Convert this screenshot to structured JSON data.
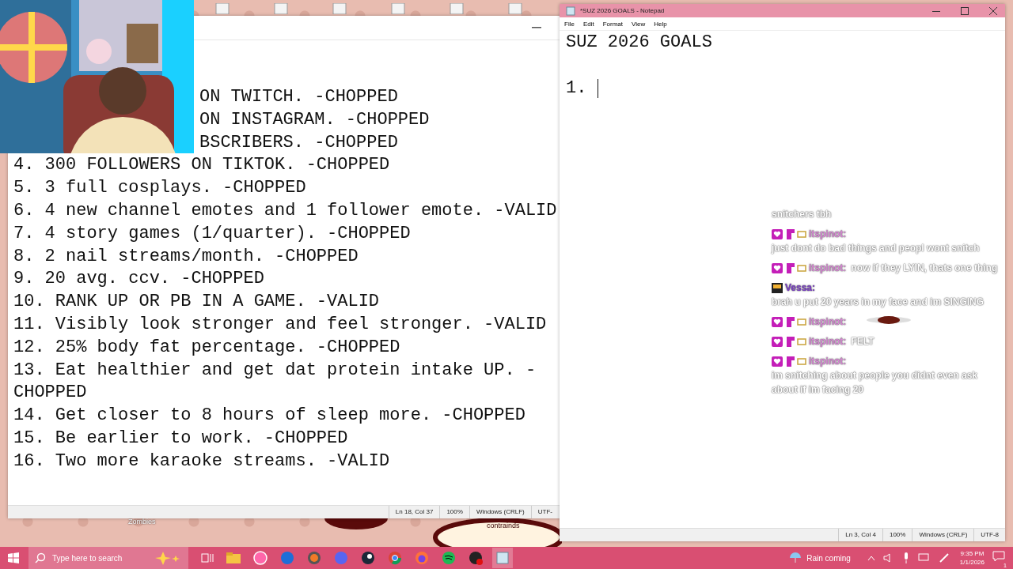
{
  "webcam": {
    "kind": "picture"
  },
  "left_notepad": {
    "covered_lines": [
      "ON TWITCH. -CHOPPED",
      "ON INSTAGRAM. -CHOPPED",
      "BSCRIBERS. -CHOPPED"
    ],
    "lines": [
      "4. 300 FOLLOWERS ON TIKTOK. -CHOPPED",
      "5. 3 full cosplays. -CHOPPED",
      "6. 4 new channel emotes and 1 follower emote. -VALID",
      "7. 4 story games (1/quarter). -CHOPPED",
      "8. 2 nail streams/month. -CHOPPED",
      "9. 20 avg. ccv. -CHOPPED",
      "10. RANK UP OR PB IN A GAME. -VALID",
      "11. Visibly look stronger and feel stronger. -VALID",
      "12. 25% body fat percentage. -CHOPPED",
      "13. Eat healthier and get dat protein intake UP. -CHOPPED",
      "14. Get closer to 8 hours of sleep more. -CHOPPED",
      "15. Be earlier to work. -CHOPPED",
      "16. Two more karaoke streams. -VALID"
    ],
    "status_bar": [
      "Ln 18, Col 37",
      "100%",
      "Windows (CRLF)",
      "UTF-"
    ]
  },
  "right_notepad": {
    "title": "*SUZ 2026 GOALS - Notepad",
    "menu": [
      "File",
      "Edit",
      "Format",
      "View",
      "Help"
    ],
    "heading": "SUZ 2026 GOALS",
    "list_start": "1.",
    "status_bar": [
      "Ln 3, Col 4",
      "100%",
      "Windows (CRLF)",
      "UTF-8"
    ]
  },
  "chat": {
    "messages": [
      {
        "kind": "continuation",
        "text": "snitchers tbh"
      },
      {
        "kind": "text",
        "user": "itspinot:",
        "color": "#d98ad6",
        "text": "just dont do bad things and peopl wont snitch"
      },
      {
        "kind": "text",
        "user": "itspinot:",
        "color": "#d98ad6",
        "text": "now if they LYIN, thats one thing"
      },
      {
        "kind": "text",
        "user": "Vessa:",
        "color": "#7a3fc4",
        "text": "brah u put 20 years in my face and im SINGING"
      },
      {
        "kind": "emote",
        "user": "itspinot:",
        "color": "#d98ad6"
      },
      {
        "kind": "text",
        "user": "itspinot:",
        "color": "#d98ad6",
        "text": "FELT"
      },
      {
        "kind": "text",
        "user": "itspinot:",
        "color": "#d98ad6",
        "text": "im snitching about people you didnt even ask about if im facing 20"
      }
    ]
  },
  "desktop_labels": [
    "Zombies",
    "contrainds"
  ],
  "taskbar": {
    "search": {
      "placeholder": "Type here to search"
    },
    "weather": "Rain coming",
    "time": "9:35 PM",
    "date": "1/1/2026",
    "notifications": "1"
  }
}
